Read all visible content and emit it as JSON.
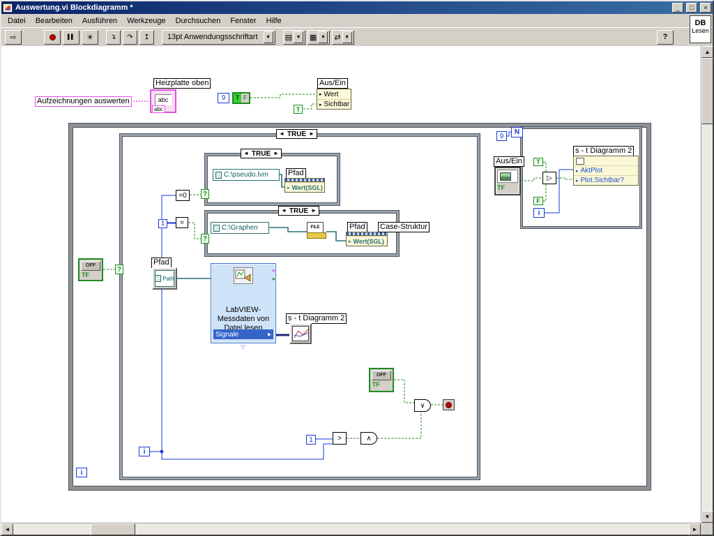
{
  "colors": {
    "numeric_blue": "#1638d8",
    "boolean_green": "#1e8c1e",
    "path_teal": "#2a7070",
    "string_pink": "#e24fe2",
    "express_fill": "#cfe3f8",
    "express_border": "#3c78c8",
    "selected_row_blue": "#3464c8",
    "titlebar_start": "#0a246a",
    "titlebar_end": "#3a6ea5",
    "chrome_gray": "#d4d0c8",
    "stop_red": "#c00000"
  },
  "window": {
    "title": "Auswertung.vi Blockdiagramm *",
    "minimize": "_",
    "restore": "□",
    "close": "×"
  },
  "menu": {
    "items": [
      "Datei",
      "Bearbeiten",
      "Ausführen",
      "Werkzeuge",
      "Durchsuchen",
      "Fenster",
      "Hilfe"
    ]
  },
  "toolbar": {
    "run_icon": "⇨",
    "pause_icon": "▌▌",
    "highlight_icon": "☀",
    "step_into_icon": "↴",
    "step_over_icon": "↷",
    "step_out_icon": "↥",
    "font_selector": "13pt Anwendungsschriftart",
    "dropdown_arrow": "▼",
    "align_icon": "▤",
    "distribute_icon": "▦",
    "reorder_icon": "⇄",
    "help_icon": "?",
    "db_line1": "DB",
    "db_line2": "Lesen"
  },
  "scrollbar": {
    "up": "▲",
    "down": "▼",
    "left": "◄",
    "right": "►"
  },
  "diagram": {
    "labels": {
      "heizplatte": "Heizplatte oben",
      "aufzeichnungen": "Aufzeichnungen auswerten",
      "aus_ein_top": "Aus/Ein",
      "aus_ein_right": "Aus/Ein",
      "pfad1": "Pfad",
      "pfad2": "Pfad",
      "pfad_control": "Pfad",
      "case_struktur": "Case-Struktur",
      "diagramm2_terminal": "s - t Diagramm 2",
      "diagramm2_property": "s - t Diagramm 2"
    },
    "case_selectors": {
      "arrow_left": "◄",
      "arrow_right": "►",
      "main": "TRUE",
      "inner1": "TRUE",
      "inner2": "TRUE"
    },
    "constants": {
      "nine_top": "9",
      "nine_right": "9",
      "one_mid": "1",
      "one_bottom": "1",
      "tf_pair_t": "T",
      "tf_pair_f": "F",
      "t_small": "T",
      "t_right": "T",
      "f_right": "F",
      "abc": "abc",
      "off": "OFF",
      "tf": "TF",
      "i": "i",
      "n": "N",
      "q": "?",
      "path_text": "Path",
      "file_text": "FILE"
    },
    "nodes": {
      "equals_zero": "=0",
      "equals": "=",
      "greater": ">",
      "and": "∧",
      "or": "∨",
      "select": "▷"
    },
    "property_rows": {
      "aus_ein": [
        "Wert",
        "Sichtbar"
      ],
      "pfad1": [
        "Wert(SGL)"
      ],
      "pfad2": [
        "Wert(SGL)"
      ],
      "diagramm2": [
        "AktPlot",
        "Plot.Sichtbar?"
      ]
    },
    "paths": {
      "pseudo": "C:\\pseudo.lvm",
      "graphen": "C:\\Graphen"
    },
    "express_vi": {
      "lines": [
        "LabVIEW-",
        "Messdaten von",
        "Datei lesen"
      ],
      "output": "Signale"
    },
    "icons": {
      "row_arrow": "▸",
      "collapse": "▽"
    }
  }
}
